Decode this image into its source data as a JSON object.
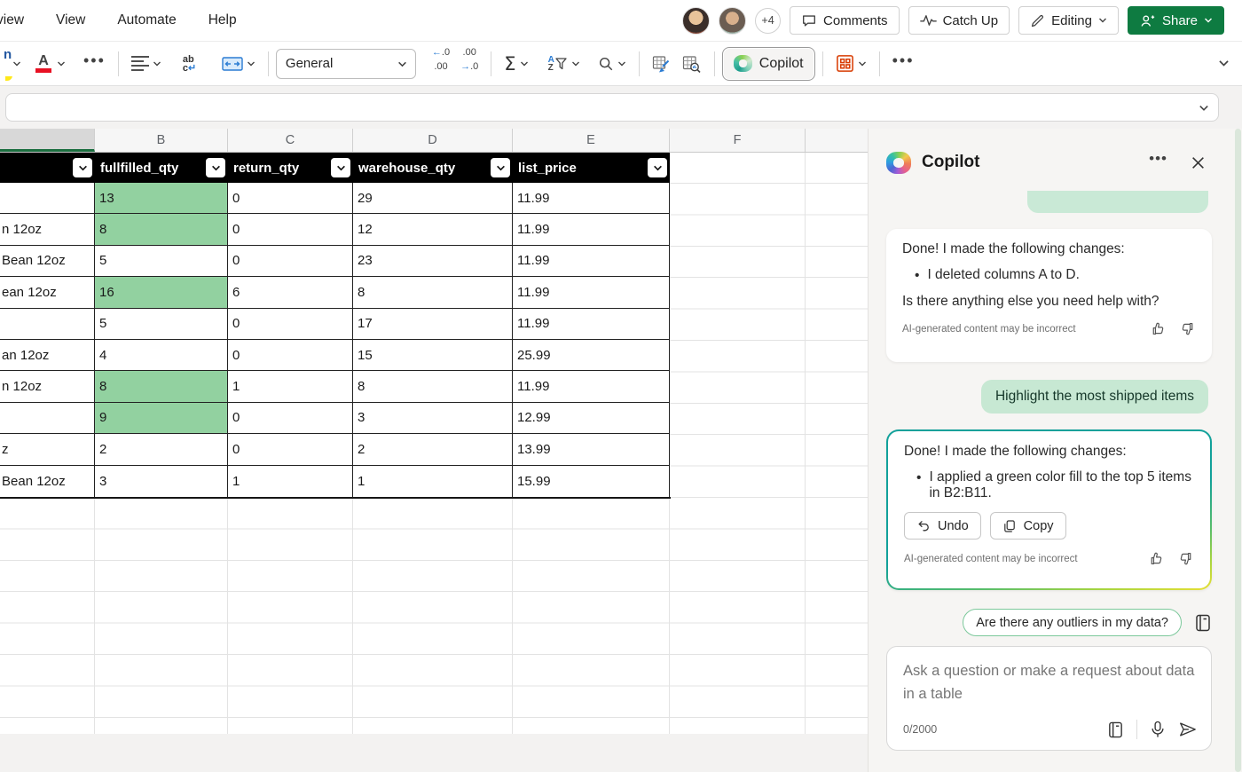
{
  "menu": {
    "items": [
      {
        "label": "view"
      },
      {
        "label": "View"
      },
      {
        "label": "Automate"
      },
      {
        "label": "Help"
      }
    ]
  },
  "topbar": {
    "presence_overflow": "+4",
    "comments_label": "Comments",
    "catchup_label": "Catch Up",
    "editing_label": "Editing",
    "share_label": "Share"
  },
  "toolbar": {
    "number_format_value": "General",
    "copilot_label": "Copilot"
  },
  "sheet": {
    "col_letters": [
      {
        "l": ""
      },
      {
        "l": "B"
      },
      {
        "l": "C"
      },
      {
        "l": "D"
      },
      {
        "l": "E"
      },
      {
        "l": "F"
      }
    ],
    "table_header": {
      "col_b": "fullfilled_qty",
      "col_c": "return_qty",
      "col_d": "warehouse_qty",
      "col_e": "list_price"
    },
    "rows": [
      {
        "a": "",
        "b": "13",
        "c": "0",
        "d": "29",
        "e": "11.99",
        "b_green": true
      },
      {
        "a": "n 12oz",
        "b": "8",
        "c": "0",
        "d": "12",
        "e": "11.99",
        "b_green": true
      },
      {
        "a": "Bean 12oz",
        "b": "5",
        "c": "0",
        "d": "23",
        "e": "11.99",
        "b_green": false
      },
      {
        "a": "ean 12oz",
        "b": "16",
        "c": "6",
        "d": "8",
        "e": "11.99",
        "b_green": true
      },
      {
        "a": "",
        "b": "5",
        "c": "0",
        "d": "17",
        "e": "11.99",
        "b_green": false
      },
      {
        "a": "an 12oz",
        "b": "4",
        "c": "0",
        "d": "15",
        "e": "25.99",
        "b_green": false
      },
      {
        "a": "n 12oz",
        "b": "8",
        "c": "1",
        "d": "8",
        "e": "11.99",
        "b_green": true
      },
      {
        "a": "",
        "b": "9",
        "c": "0",
        "d": "3",
        "e": "12.99",
        "b_green": true
      },
      {
        "a": "z",
        "b": "2",
        "c": "0",
        "d": "2",
        "e": "13.99",
        "b_green": false
      },
      {
        "a": "Bean 12oz",
        "b": "3",
        "c": "1",
        "d": "1",
        "e": "15.99",
        "b_green": false
      }
    ]
  },
  "copilot": {
    "title": "Copilot",
    "card1": {
      "line1": "Done! I made the following changes:",
      "bullet": "I deleted columns A to D.",
      "line2": "Is there anything else you need help with?",
      "disclaimer": "AI-generated content may be incorrect"
    },
    "user_message": "Highlight the most shipped items",
    "card2": {
      "line1": "Done! I made the following changes:",
      "bullet": "I applied a green color fill to the top 5 items in B2:B11.",
      "undo_label": "Undo",
      "copy_label": "Copy",
      "disclaimer": "AI-generated content may be incorrect"
    },
    "suggestion_chip": "Are there any outliers in my data?",
    "input": {
      "placeholder": "Ask a question or make a request about data in a table",
      "counter": "0/2000"
    }
  },
  "colors": {
    "excel_green": "#0e7b41",
    "highlight_cell_green": "#92d1a0",
    "user_bubble_green": "#c7e8d3"
  }
}
